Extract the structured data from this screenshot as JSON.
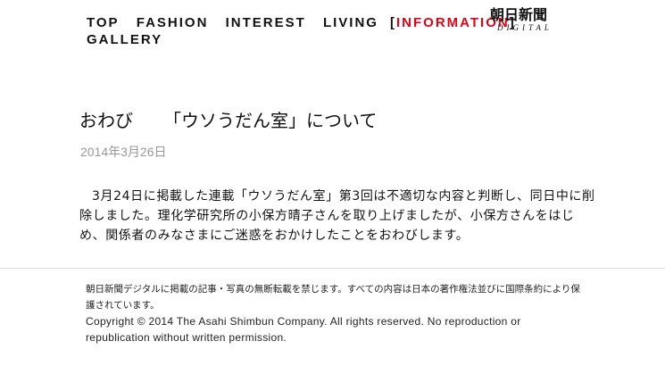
{
  "nav": {
    "items": [
      "TOP",
      "FASHION",
      "INTEREST",
      "LIVING",
      "INFORMATION",
      "GALLERY"
    ],
    "bracket_open": "[",
    "bracket_close": "]",
    "accent_color": "#e60012"
  },
  "logo": {
    "name": "朝日新聞",
    "sub": "DIGITAL"
  },
  "article": {
    "title_prefix": "おわび",
    "title_main": "「ウソうだん室」について",
    "date": "2014年3月26日",
    "body": "3月24日に掲載した連載「ウソうだん室」第3回は不適切な内容と判断し、同日中に削除しました。理化学研究所の小保方晴子さんを取り上げましたが、小保方さんをはじめ、関係者のみなさまにご迷惑をおかけしたことをおわびします。"
  },
  "footer": {
    "notice": "朝日新聞デジタルに掲載の記事・写真の無断転載を禁じます。すべての内容は日本の著作権法並びに国際条約により保護されています。",
    "copyright": "Copyright © 2014 The Asahi Shimbun Company. All rights reserved. No reproduction or republication without written permission."
  }
}
